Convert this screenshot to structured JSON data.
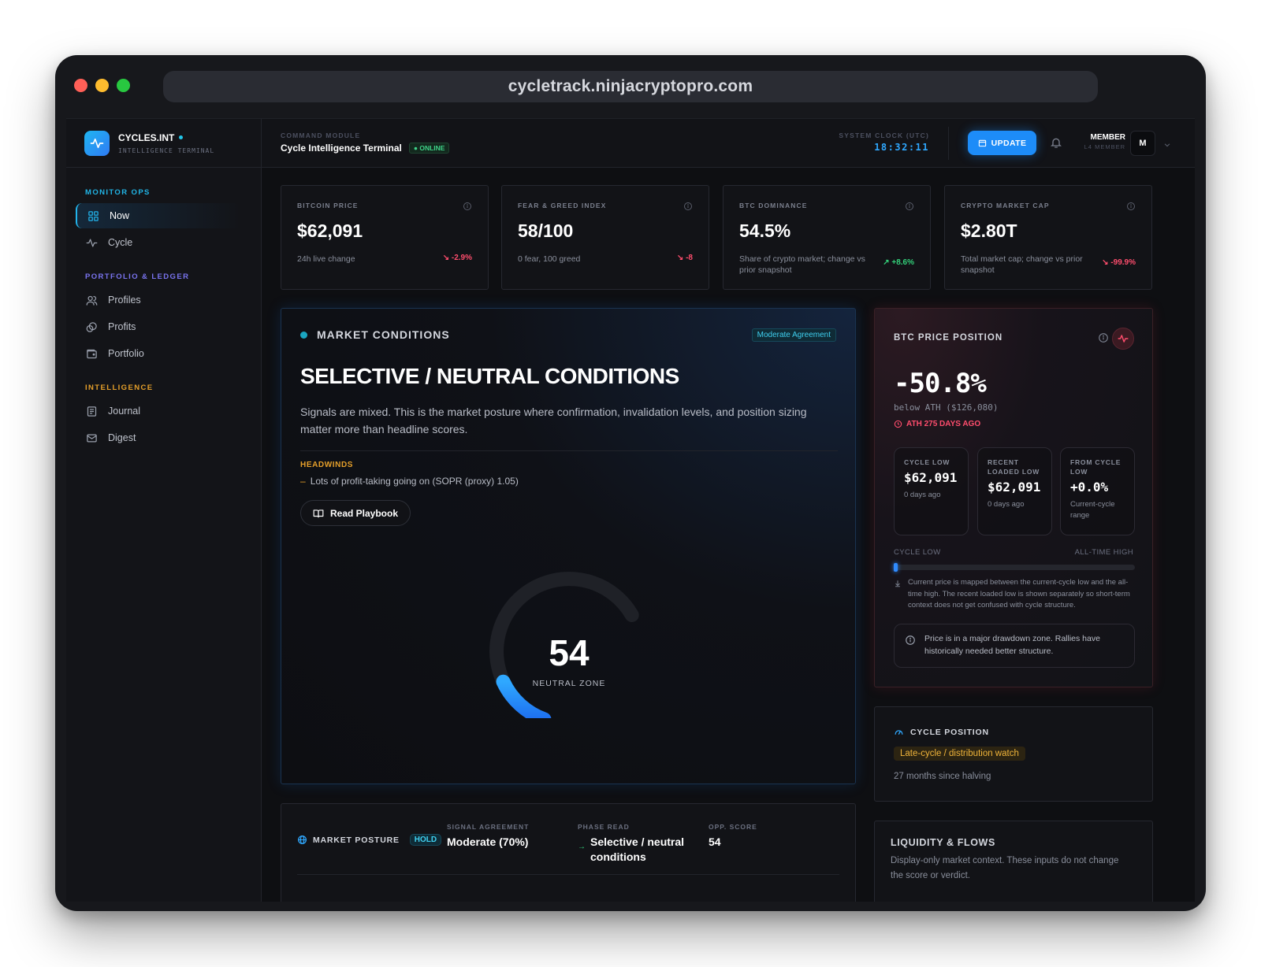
{
  "browser": {
    "url": "cycletrack.ninjacryptopro.com"
  },
  "brand": {
    "name": "CYCLES.INT",
    "subtitle": "INTELLIGENCE TERMINAL",
    "accent": "#21b5e6"
  },
  "sidebar": {
    "sections": [
      {
        "title": "MONITOR OPS",
        "items": [
          {
            "label": "Now",
            "icon": "grid-icon",
            "active": true
          },
          {
            "label": "Cycle",
            "icon": "pulse-icon"
          }
        ]
      },
      {
        "title": "PORTFOLIO & LEDGER",
        "items": [
          {
            "label": "Profiles",
            "icon": "users-icon"
          },
          {
            "label": "Profits",
            "icon": "coins-icon"
          },
          {
            "label": "Portfolio",
            "icon": "wallet-icon"
          }
        ]
      },
      {
        "title": "INTELLIGENCE",
        "items": [
          {
            "label": "Journal",
            "icon": "journal-icon"
          },
          {
            "label": "Digest",
            "icon": "mail-icon"
          }
        ]
      }
    ]
  },
  "header": {
    "module_label": "COMMAND MODULE",
    "module_title": "Cycle Intelligence Terminal",
    "status": "ONLINE",
    "clock_label": "SYSTEM CLOCK (UTC)",
    "clock_value": "18:32:11",
    "update_label": "UPDATE",
    "member_name": "MEMBER",
    "member_tier": "L4 MEMBER",
    "avatar_initial": "M"
  },
  "stats": [
    {
      "label": "BITCOIN PRICE",
      "value": "$62,091",
      "sub": "24h live change",
      "change": "-2.9%",
      "direction": "down"
    },
    {
      "label": "FEAR & GREED INDEX",
      "value": "58/100",
      "sub": "0 fear, 100 greed",
      "change": "-8",
      "direction": "down"
    },
    {
      "label": "BTC DOMINANCE",
      "value": "54.5%",
      "sub": "Share of crypto market; change vs prior snapshot",
      "change": "+8.6%",
      "direction": "up"
    },
    {
      "label": "CRYPTO MARKET CAP",
      "value": "$2.80T",
      "sub": "Total market cap; change vs prior snapshot",
      "change": "-99.9%",
      "direction": "down"
    }
  ],
  "market": {
    "heading": "MARKET CONDITIONS",
    "agreement": "Moderate Agreement",
    "title": "SELECTIVE / NEUTRAL CONDITIONS",
    "description": "Signals are mixed. This is the market posture where confirmation, invalidation levels, and position sizing matter more than headline scores.",
    "headwinds_label": "HEADWINDS",
    "headwinds": [
      "Lots of profit-taking going on (SOPR (proxy) 1.05)"
    ],
    "playbook_label": "Read Playbook",
    "gauge_value": "54",
    "gauge_score": 54,
    "gauge_label": "NEUTRAL ZONE"
  },
  "btc_position": {
    "title": "BTC PRICE POSITION",
    "value": "-50.8%",
    "below": "below ATH ($126,080)",
    "ath_ago": "ATH 275 DAYS AGO",
    "cards": [
      {
        "label": "CYCLE LOW",
        "value": "$62,091",
        "sub": "0 days ago"
      },
      {
        "label": "RECENT LOADED LOW",
        "value": "$62,091",
        "sub": "0 days ago"
      },
      {
        "label": "FROM CYCLE LOW",
        "value": "+0.0%",
        "sub": "Current-cycle range"
      }
    ],
    "range_left": "CYCLE LOW",
    "range_right": "ALL-TIME HIGH",
    "range_position": 0.0,
    "range_note": "Current price is mapped between the current-cycle low and the all-time high. The recent loaded low is shown separately so short-term context does not get confused with cycle structure.",
    "warning": "Price is in a major drawdown zone. Rallies have historically needed better structure."
  },
  "cycle_position": {
    "title": "CYCLE POSITION",
    "badge": "Late-cycle / distribution watch",
    "sub": "27 months since halving"
  },
  "liquidity": {
    "title": "LIQUIDITY & FLOWS",
    "sub": "Display-only market context. These inputs do not change the score or verdict."
  },
  "posture": {
    "title": "MARKET POSTURE",
    "badge": "HOLD",
    "agreement_label": "SIGNAL AGREEMENT",
    "agreement_value": "Moderate (70%)",
    "phase_label": "PHASE READ",
    "phase_value": "Selective / neutral conditions",
    "score_label": "OPP. SCORE",
    "score_value": "54"
  },
  "colors": {
    "negative": "#ff4d6d",
    "positive": "#33d17a",
    "primary": "#1d8cf8",
    "warning": "#e6a02a"
  }
}
